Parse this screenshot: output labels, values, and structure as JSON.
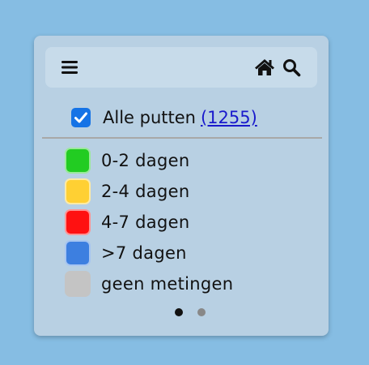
{
  "toolbar": {
    "menu_icon": "menu-icon",
    "home_icon": "home-icon",
    "search_icon": "search-icon"
  },
  "filter": {
    "all_label": "Alle putten",
    "count": "(1255)",
    "checked": true
  },
  "legend": [
    {
      "label": "0-2 dagen",
      "color": "#22cc22"
    },
    {
      "label": "2-4 dagen",
      "color": "#ffd033"
    },
    {
      "label": "4-7 dagen",
      "color": "#ff1111"
    },
    {
      "label": ">7 dagen",
      "color": "#3d7fe0"
    },
    {
      "label": "geen metingen",
      "color": "#c4c4c4"
    }
  ],
  "pagination": {
    "total_pages": 2,
    "active_page": 1
  },
  "colors": {
    "background": "#86bde3",
    "checkbox": "#1573e6",
    "link": "#1a1acc"
  }
}
